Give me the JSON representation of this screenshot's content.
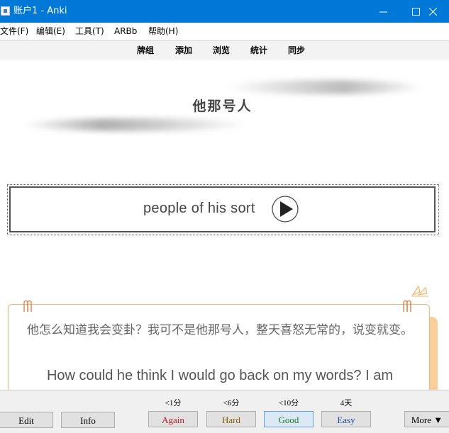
{
  "window": {
    "title": "账户1 - Anki",
    "minimize_label": "minimize",
    "maximize_label": "maximize",
    "close_label": "close"
  },
  "menu": [
    "文件(F)",
    "编辑(E)",
    "工具(T)",
    "ARBb",
    "帮助(H)"
  ],
  "toolbar": [
    "牌组",
    "添加",
    "浏览",
    "统计",
    "同步"
  ],
  "card": {
    "front": "他那号人",
    "audio_text": "people of his sort",
    "example_cn": "他怎么知道我会变卦？我可不是他那号人，整天喜怒无常的，说变就变。",
    "example_en": "How could he think I would go back on my words? I am"
  },
  "bottom": {
    "edit": "Edit",
    "info": "Info",
    "answers": [
      {
        "interval": "<1分",
        "label": "Again",
        "color": "#b22222"
      },
      {
        "interval": "<6分",
        "label": "Hard",
        "color": "#8b5a00"
      },
      {
        "interval": "<10分",
        "label": "Good",
        "color": "#1a7a1a"
      },
      {
        "interval": "4天",
        "label": "Easy",
        "color": "#1f4fa3"
      }
    ],
    "more": "More ▼"
  },
  "colors": {
    "titlebar": "#0078d7",
    "accent_orange": "#f1b36e",
    "good_highlight": "#dbe9f7"
  }
}
